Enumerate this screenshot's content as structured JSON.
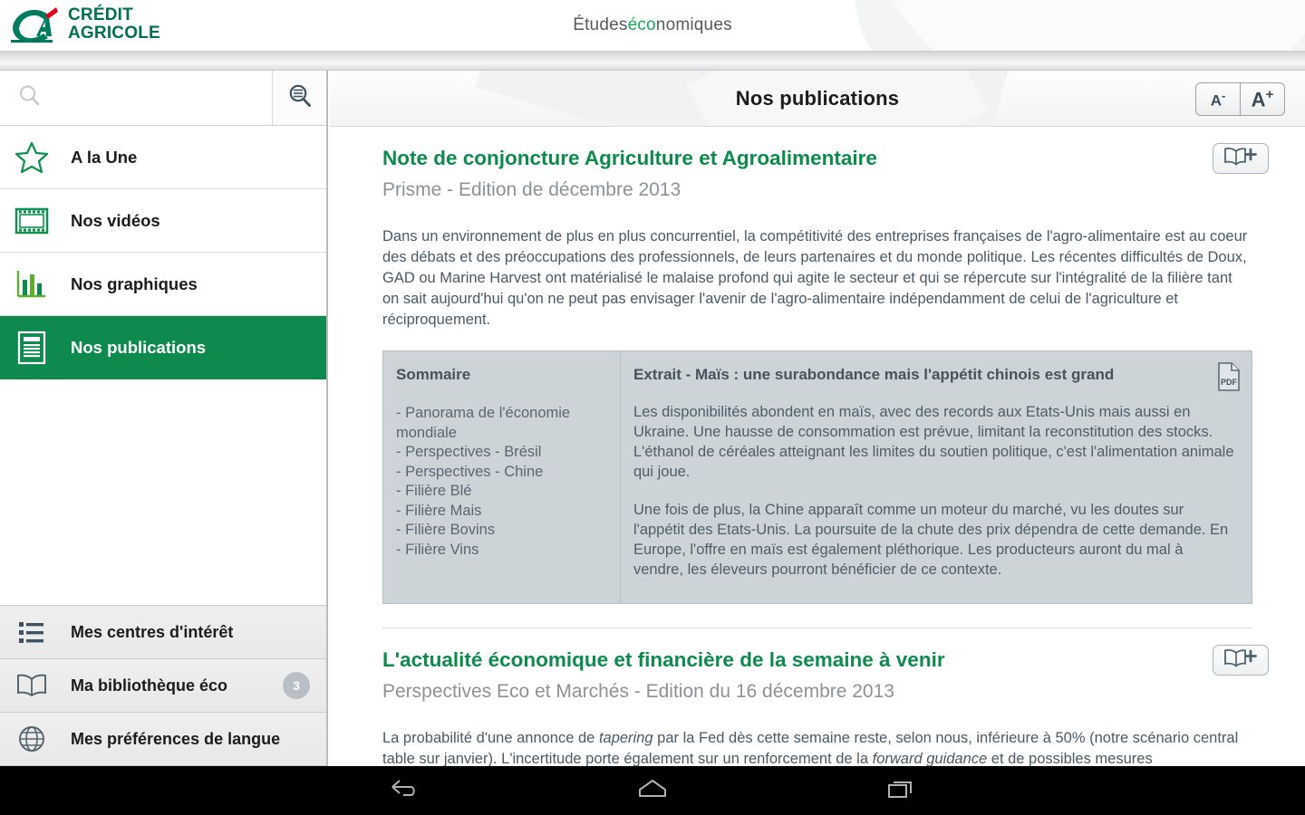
{
  "app": {
    "brand_line1": "CRÉDIT",
    "brand_line2": "AGRICOLE",
    "title_prefix": "Études ",
    "title_accent": "éco",
    "title_suffix": "nomiques",
    "accent_green": "#16a85c",
    "brand_green": "#00704f",
    "active_green": "#0f8a4f"
  },
  "sidebar": {
    "search": {
      "value": "",
      "placeholder": "",
      "icon": "search-icon"
    },
    "advanced_search_icon": "advanced-search-icon",
    "items": [
      {
        "label": "A la Une",
        "icon": "star-icon",
        "active": false
      },
      {
        "label": "Nos vidéos",
        "icon": "film-icon",
        "active": false
      },
      {
        "label": "Nos graphiques",
        "icon": "bar-chart-icon",
        "active": false
      },
      {
        "label": "Nos publications",
        "icon": "document-icon",
        "active": true
      }
    ],
    "bottom_items": [
      {
        "label": "Mes centres d'intérêt",
        "icon": "list-icon",
        "badge": ""
      },
      {
        "label": "Ma bibliothèque éco",
        "icon": "book-icon",
        "badge": "3"
      },
      {
        "label": "Mes préférences de langue",
        "icon": "globe-icon",
        "badge": ""
      }
    ]
  },
  "main": {
    "header_title": "Nos publications",
    "font_decrease_label": "A",
    "font_decrease_sup": "-",
    "font_increase_label": "A",
    "font_increase_sup": "+",
    "bookmark_icon": "book-plus-icon",
    "pdf_icon": "pdf-icon"
  },
  "articles": [
    {
      "title": "Note de conjoncture Agriculture et Agroalimentaire",
      "subtitle": "Prisme - Edition de décembre 2013",
      "body": "Dans un environnement de plus en plus concurrentiel, la compétitivité des entreprises françaises de l'agro-alimentaire est au coeur des débats et des préoccupations des professionnels, de leurs partenaires et du monde politique. Les récentes difficultés de Doux, GAD ou Marine Harvest ont matérialisé le malaise profond qui agite le secteur et qui se répercute sur l'intégralité de la filière tant on sait aujourd'hui qu'on ne peut pas envisager l'avenir de l'agro-alimentaire indépendamment de celui de l'agriculture et réciproquement.",
      "summary_heading": "Sommaire",
      "summary_items": [
        "- Panorama de l'économie mondiale",
        "- Perspectives - Brésil",
        "- Perspectives - Chine",
        "- Filière Blé",
        "- Filière Mais",
        "- Filière Bovins",
        "- Filière Vins"
      ],
      "extract_heading": "Extrait - Maïs : une surabondance mais l'appétit chinois est grand",
      "extract_p1": "Les disponibilités abondent en maïs, avec des records aux Etats-Unis mais aussi en Ukraine. Une hausse de consommation est prévue, limitant la reconstitution des stocks. L'éthanol de céréales atteignant les limites du soutien politique, c'est l'alimentation animale qui joue.",
      "extract_p2": "Une fois de plus, la Chine apparaît comme un moteur du marché, vu les doutes sur l'appétit des Etats-Unis. La poursuite de la chute des prix dépendra de cette demande. En Europe, l'offre en maïs est également pléthorique. Les producteurs auront du mal à vendre, les éleveurs pourront bénéficier de ce contexte."
    },
    {
      "title": "L'actualité économique et financière de la semaine à venir",
      "subtitle": "Perspectives Eco et Marchés - Edition du 16 décembre 2013",
      "body_part1": "La probabilité d'une annonce de ",
      "body_em1": "tapering",
      "body_part2": " par la Fed dès cette semaine reste, selon nous, inférieure à 50% (notre scénario central table sur janvier). L'incertitude porte également sur un renforcement de la ",
      "body_em2": "forward guidance",
      "body_part3": " et de possibles mesures d'accompagnement. Le dernier sommet de l'UE de l'année se focalisera pour l'essentiel sur l'union"
    }
  ],
  "android_nav": {
    "back_icon": "back-icon",
    "home_icon": "home-icon",
    "recents_icon": "recents-icon"
  }
}
